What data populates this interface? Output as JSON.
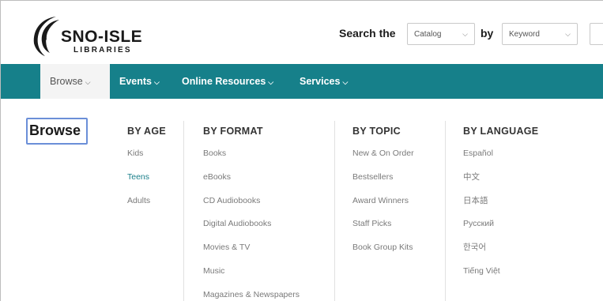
{
  "header": {
    "logo": {
      "name": "SNO-ISLE",
      "subtitle": "LIBRARIES"
    },
    "search": {
      "label": "Search the",
      "scope_value": "Catalog",
      "by_label": "by",
      "type_value": "Keyword"
    }
  },
  "nav": {
    "items": [
      {
        "label": "Browse"
      },
      {
        "label": "Events"
      },
      {
        "label": "Online Resources"
      },
      {
        "label": "Services"
      }
    ]
  },
  "menu": {
    "title": "Browse",
    "columns": [
      {
        "heading": "BY AGE",
        "items": [
          "Kids",
          "Teens",
          "Adults"
        ]
      },
      {
        "heading": "BY FORMAT",
        "items": [
          "Books",
          "eBooks",
          "CD Audiobooks",
          "Digital Audiobooks",
          "Movies & TV",
          "Music",
          "Magazines & Newspapers"
        ]
      },
      {
        "heading": "BY TOPIC",
        "items": [
          "New & On Order",
          "Bestsellers",
          "Award Winners",
          "Staff Picks",
          "Book Group Kits"
        ]
      },
      {
        "heading": "BY LANGUAGE",
        "items": [
          "Español",
          "中文",
          "日本語",
          "Русский",
          "한국어",
          "Tiếng Việt"
        ]
      }
    ]
  },
  "colors": {
    "nav_background": "#16808a",
    "active_link": "#1a7f8a",
    "focus_outline": "#6b8fd8"
  },
  "icons": {
    "dropdown": "chevron-down-icon",
    "logo_mark": "sno-isle-swoosh-logo"
  }
}
